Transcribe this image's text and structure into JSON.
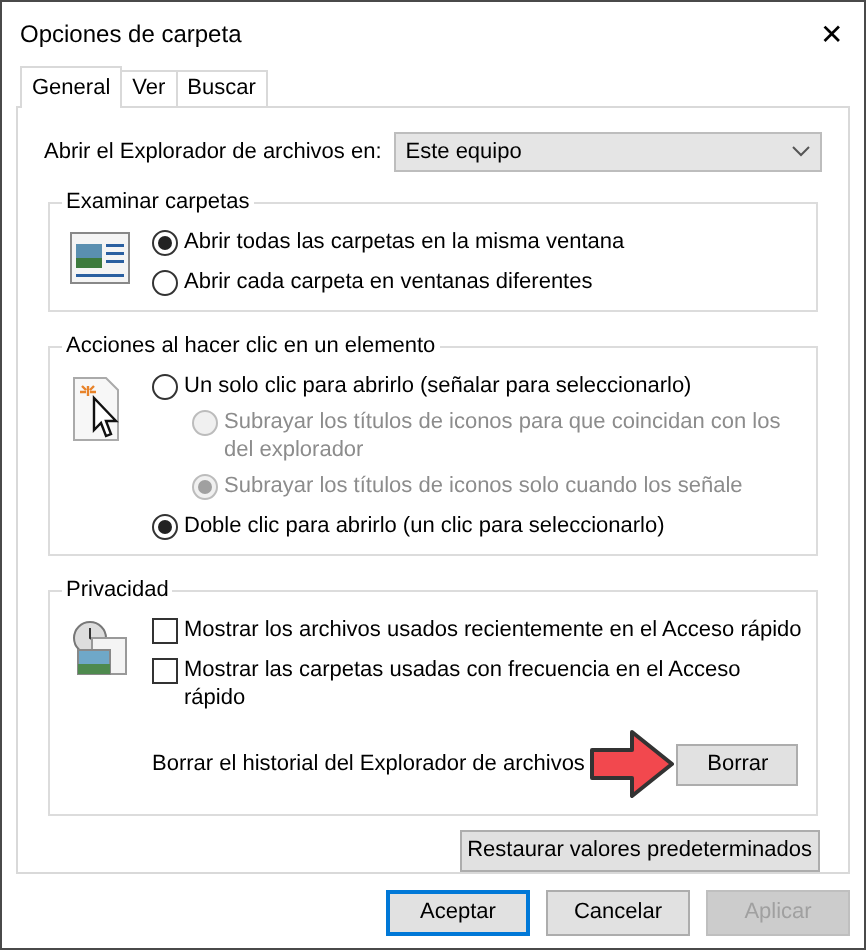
{
  "window": {
    "title": "Opciones de carpeta",
    "close": "✕"
  },
  "tabs": [
    {
      "label": "General",
      "selected": true
    },
    {
      "label": "Ver",
      "selected": false
    },
    {
      "label": "Buscar",
      "selected": false
    }
  ],
  "open_explorer": {
    "label": "Abrir el Explorador de archivos en:",
    "value": "Este equipo"
  },
  "browse_folders": {
    "title": "Examinar carpetas",
    "options": [
      {
        "label": "Abrir todas las carpetas en la misma ventana",
        "selected": true,
        "disabled": false
      },
      {
        "label": "Abrir cada carpeta en ventanas diferentes",
        "selected": false,
        "disabled": false
      }
    ]
  },
  "click_actions": {
    "title": "Acciones al hacer clic en un elemento",
    "options": [
      {
        "label": "Un solo clic para abrirlo (señalar para seleccionarlo)",
        "selected": false,
        "disabled": false,
        "children": [
          {
            "label": "Subrayar los títulos de iconos para que coincidan con los del explorador",
            "selected": false,
            "disabled": true
          },
          {
            "label": "Subrayar los títulos de iconos solo cuando los señale",
            "selected": true,
            "disabled": true
          }
        ]
      },
      {
        "label": "Doble clic para abrirlo (un clic para seleccionarlo)",
        "selected": true,
        "disabled": false
      }
    ]
  },
  "privacy": {
    "title": "Privacidad",
    "options": [
      {
        "label": "Mostrar los archivos usados recientemente en el Acceso rápido",
        "checked": false
      },
      {
        "label": "Mostrar las carpetas usadas con frecuencia en el Acceso rápido",
        "checked": false
      }
    ],
    "clear_label": "Borrar el historial del Explorador de archivos",
    "clear_button": "Borrar"
  },
  "restore_button": "Restaurar valores predeterminados",
  "buttons": [
    {
      "label": "Aceptar",
      "default": true,
      "disabled": false
    },
    {
      "label": "Cancelar",
      "default": false,
      "disabled": false
    },
    {
      "label": "Aplicar",
      "default": false,
      "disabled": true
    }
  ]
}
